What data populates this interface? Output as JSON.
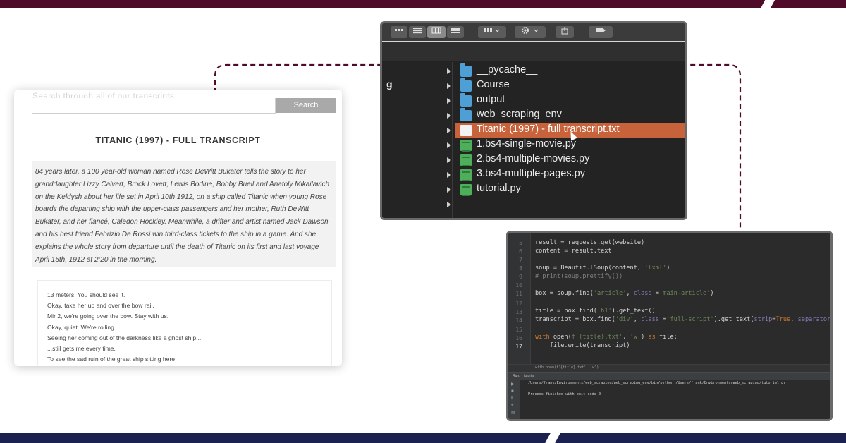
{
  "web_page": {
    "faint_header": "Search through all of our transcripts",
    "search_button": "Search",
    "title": "TITANIC (1997) - FULL TRANSCRIPT",
    "summary": "84 years later, a 100 year-old woman named Rose DeWitt Bukater tells the story to her granddaughter Lizzy Calvert, Brock Lovett, Lewis Bodine, Bobby Buell and Anatoly Mikailavich on the Keldysh about her life set in April 10th 1912, on a ship called Titanic when young Rose boards the departing ship with the upper-class passengers and her mother, Ruth DeWitt Bukater, and her fiancé, Caledon Hockley. Meanwhile, a drifter and artist named Jack Dawson and his best friend Fabrizio De Rossi win third-class tickets to the ship in a game. And she explains the whole story from departure until the death of Titanic on its first and last voyage April 15th, 1912 at 2:20 in the morning.",
    "script_lines": [
      "13 meters. You should see it.",
      "Okay, take her up and over the bow rail.",
      "Mir 2, we're going over the bow. Stay with us.",
      "Okay, quiet. We're rolling.",
      "Seeing her coming out of the darkness like a ghost ship...",
      "...still gets me every time.",
      "To see the sad ruin of the great ship sitting here"
    ]
  },
  "finder": {
    "left_fragment": "g",
    "files": [
      {
        "name": "__pycache__",
        "kind": "folder",
        "selected": false
      },
      {
        "name": "Course",
        "kind": "folder",
        "selected": false
      },
      {
        "name": "output",
        "kind": "folder",
        "selected": false
      },
      {
        "name": "web_scraping_env",
        "kind": "folder",
        "selected": false
      },
      {
        "name": "Titanic (1997) - full transcript.txt",
        "kind": "text",
        "selected": true
      },
      {
        "name": "1.bs4-single-movie.py",
        "kind": "python",
        "selected": false
      },
      {
        "name": "2.bs4-multiple-movies.py",
        "kind": "python",
        "selected": false
      },
      {
        "name": "3.bs4-multiple-pages.py",
        "kind": "python",
        "selected": false
      },
      {
        "name": "tutorial.py",
        "kind": "python",
        "selected": false
      }
    ]
  },
  "editor": {
    "line_numbers": [
      "5",
      "6",
      "7",
      "8",
      "9",
      "10",
      "11",
      "12",
      "13",
      "14",
      "15",
      "16",
      "17"
    ],
    "current_line": "17",
    "breadcrumb": "with open(f'{title}.txt', 'w')...",
    "run_label": "Run:",
    "run_tab": "tutorial",
    "console": [
      "/Users/frank/Environments/web_scraping/web_scraping_env/bin/python /Users/frank/Environments/web_scraping/tutorial.py",
      "",
      "Process finished with exit code 0"
    ]
  },
  "colors": {
    "top_band": "#500a2a",
    "bottom_band": "#1c2250",
    "connector": "#500a2a",
    "selection": "#c8623a"
  }
}
